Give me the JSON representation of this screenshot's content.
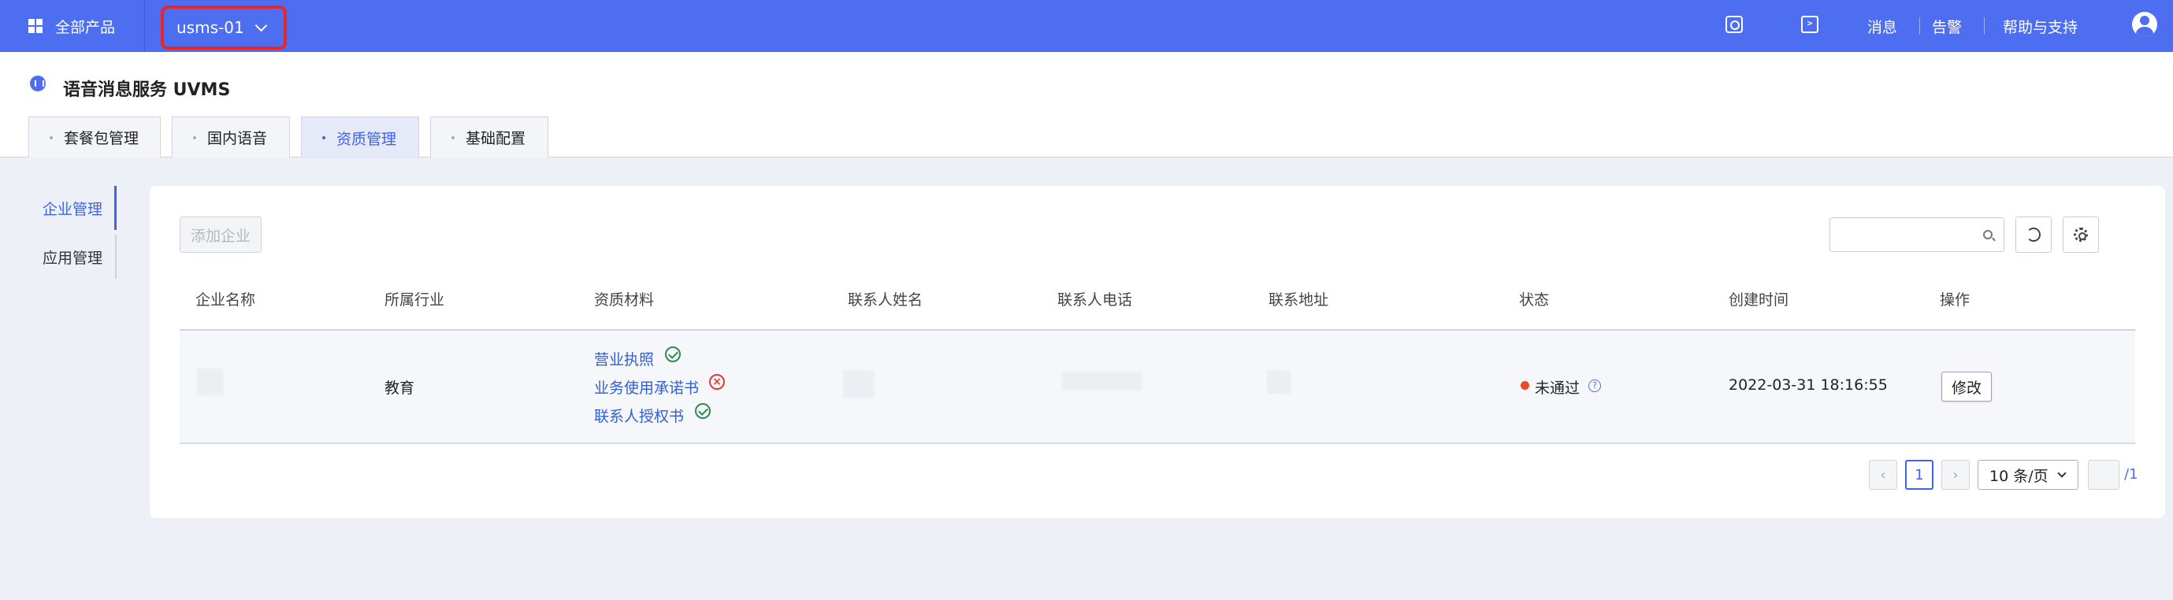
{
  "topbar": {
    "all_products": "全部产品",
    "project": "usms-01",
    "messages": "消息",
    "alerts": "告警",
    "help": "帮助与支持",
    "icons": [
      "grid-icon",
      "chevron-down-icon",
      "search-icon",
      "terminal-icon",
      "user-avatar-icon"
    ]
  },
  "header": {
    "service_title": "语音消息服务 UVMS",
    "tabs": [
      {
        "label": "套餐包管理",
        "active": false
      },
      {
        "label": "国内语音",
        "active": false
      },
      {
        "label": "资质管理",
        "active": true
      },
      {
        "label": "基础配置",
        "active": false
      }
    ]
  },
  "sidebar": {
    "items": [
      {
        "label": "企业管理",
        "active": true
      },
      {
        "label": "应用管理",
        "active": false
      }
    ]
  },
  "toolbar": {
    "add_label": "添加企业",
    "search_value": "",
    "icons": [
      "search-icon",
      "refresh-icon",
      "settings-icon"
    ]
  },
  "table": {
    "columns": [
      "企业名称",
      "所属行业",
      "资质材料",
      "联系人姓名",
      "联系人电话",
      "联系地址",
      "状态",
      "创建时间",
      "操作"
    ],
    "rows": [
      {
        "company": "",
        "industry": "教育",
        "materials": [
          {
            "label": "营业执照",
            "status": "approved"
          },
          {
            "label": "业务使用承诺书",
            "status": "rejected"
          },
          {
            "label": "联系人授权书",
            "status": "approved"
          }
        ],
        "contact_name": "",
        "contact_phone": "",
        "address": "",
        "status": "未通过",
        "created": "2022-03-31 18:16:55",
        "action": "修改"
      }
    ]
  },
  "pagination": {
    "prev": "‹",
    "current": "1",
    "next": "›",
    "page_size": "10 条/页",
    "total_pages": "/1"
  },
  "colors": {
    "brand": "#4d6ef0",
    "accent": "#3d63e8",
    "highlight_box": "#e8262a",
    "status_failed": "#ec4a2b",
    "approved": "#2e8b4a",
    "rejected": "#e53935"
  }
}
